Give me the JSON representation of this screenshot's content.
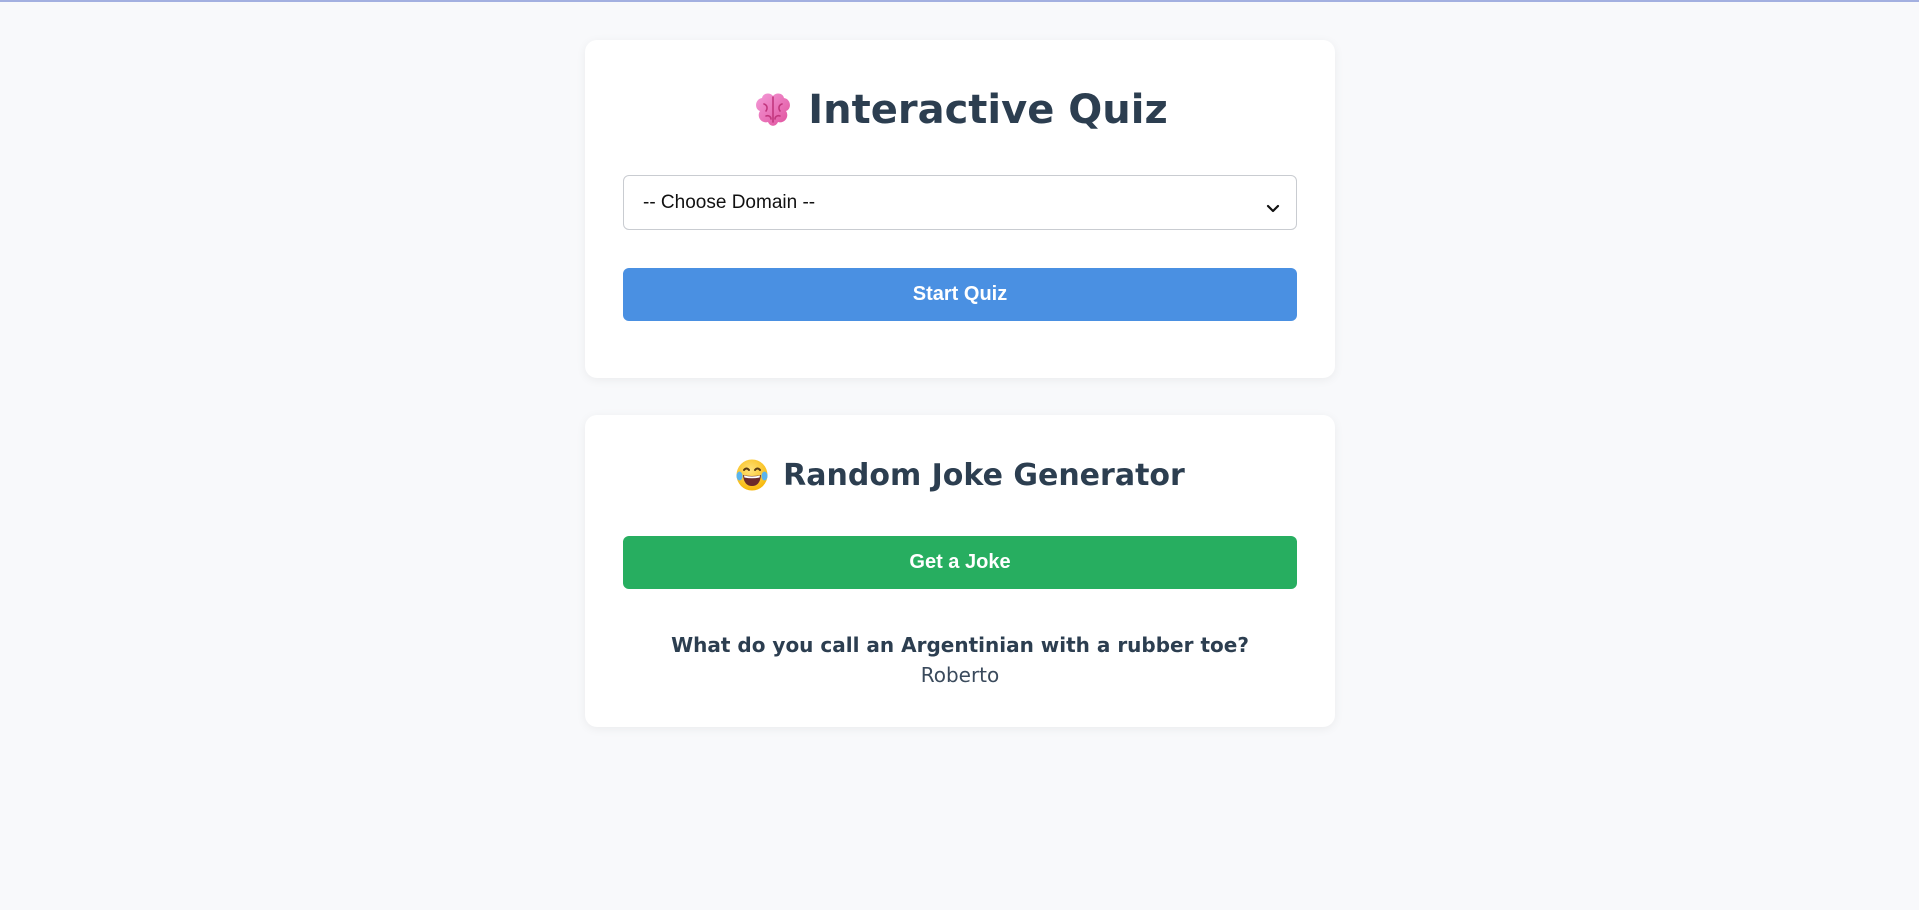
{
  "quiz": {
    "icon": "brain-icon",
    "title": "Interactive Quiz",
    "domain_select": {
      "selected": "-- Choose Domain --"
    },
    "start_label": "Start Quiz"
  },
  "joke": {
    "icon": "laughing-face-icon",
    "title": "Random Joke Generator",
    "button_label": "Get a Joke",
    "question": "What do you call an Argentinian with a rubber toe?",
    "answer": "Roberto"
  },
  "colors": {
    "primary": "#4a90e2",
    "success": "#27ae60",
    "heading": "#2c3e50",
    "background": "#f8f9fb"
  }
}
